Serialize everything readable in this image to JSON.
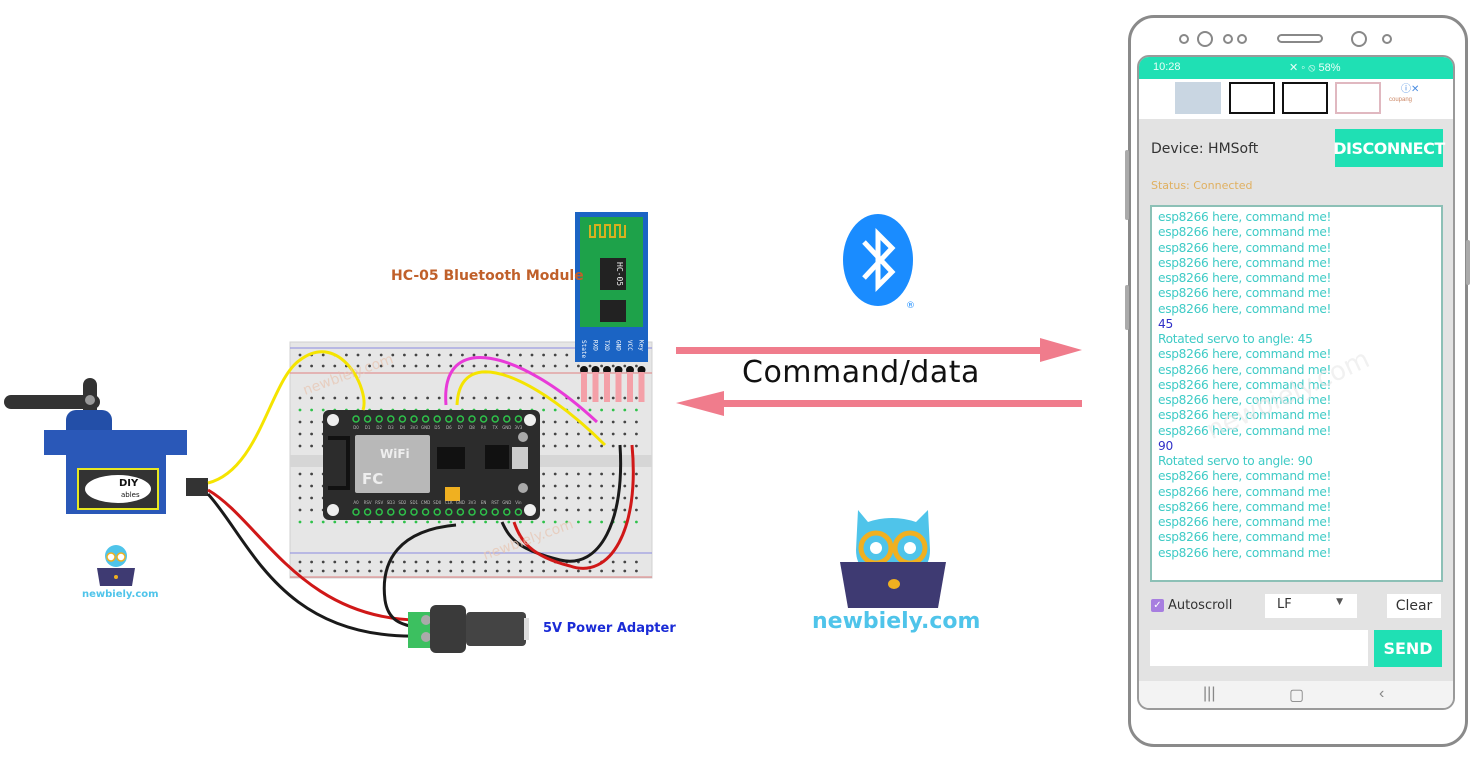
{
  "diagram": {
    "hc05_label": "HC-05 Bluetooth Module",
    "hc05_chip_text": "HC-05",
    "hc05_pins": [
      "State",
      "RXD",
      "TXD",
      "GND",
      "VCC",
      "Key"
    ],
    "power_label": "5V Power Adapter",
    "servo_brand": "DIY",
    "servo_brand_sub": "ables",
    "nodemcu_top_pins": [
      "D0",
      "D1",
      "D2",
      "D3",
      "D4",
      "3V3",
      "GND",
      "D5",
      "D6",
      "D7",
      "D8",
      "RX",
      "TX",
      "GND",
      "3V3"
    ],
    "nodemcu_bottom_pins": [
      "A0",
      "RSV",
      "RSV",
      "SD3",
      "SD2",
      "SD1",
      "CMD",
      "SD0",
      "CLK",
      "GND",
      "3V3",
      "EN",
      "RST",
      "GND",
      "Vin"
    ],
    "wifi_label": "WiFi",
    "small_logo_text": "newbiely.com",
    "watermark": "newbiely.com",
    "wire_colors": {
      "signal": "#f5e400",
      "tx": "#e83ad8",
      "power": "#d01818",
      "ground": "#1a1a1a"
    }
  },
  "center": {
    "link_label": "Command/data",
    "bluetooth_icon": "bluetooth-icon",
    "brand": "newbiely.com",
    "arrow_color": "#f07c8c",
    "bluetooth_color": "#1a8cff"
  },
  "phone": {
    "status_bar": {
      "time": "10:28",
      "battery": "58%"
    },
    "device_label": "Device: HMSoft",
    "disconnect_label": "DISCONNECT",
    "status_label": "Status: Connected",
    "monitor_lines": [
      {
        "text": "esp8266 here, command me!",
        "type": "received"
      },
      {
        "text": "esp8266 here, command me!",
        "type": "received"
      },
      {
        "text": "esp8266 here, command me!",
        "type": "received"
      },
      {
        "text": "esp8266 here, command me!",
        "type": "received"
      },
      {
        "text": "esp8266 here, command me!",
        "type": "received"
      },
      {
        "text": "esp8266 here, command me!",
        "type": "received"
      },
      {
        "text": "esp8266 here, command me!",
        "type": "received"
      },
      {
        "text": "45",
        "type": "sent"
      },
      {
        "text": "Rotated servo to angle: 45",
        "type": "received"
      },
      {
        "text": "esp8266 here, command me!",
        "type": "received"
      },
      {
        "text": "esp8266 here, command me!",
        "type": "received"
      },
      {
        "text": "esp8266 here, command me!",
        "type": "received"
      },
      {
        "text": "esp8266 here, command me!",
        "type": "received"
      },
      {
        "text": "esp8266 here, command me!",
        "type": "received"
      },
      {
        "text": "esp8266 here, command me!",
        "type": "received"
      },
      {
        "text": "90",
        "type": "sent"
      },
      {
        "text": "Rotated servo to angle: 90",
        "type": "received"
      },
      {
        "text": "esp8266 here, command me!",
        "type": "received"
      },
      {
        "text": "esp8266 here, command me!",
        "type": "received"
      },
      {
        "text": "esp8266 here, command me!",
        "type": "received"
      },
      {
        "text": "esp8266 here, command me!",
        "type": "received"
      },
      {
        "text": "esp8266 here, command me!",
        "type": "received"
      },
      {
        "text": "esp8266 here, command me!",
        "type": "received"
      }
    ],
    "autoscroll_label": "Autoscroll",
    "autoscroll_checked": true,
    "line_ending": "LF",
    "clear_label": "Clear",
    "send_input_value": "",
    "send_label": "SEND",
    "ad_brand": "coupang",
    "accent_color": "#1fe0b4"
  }
}
